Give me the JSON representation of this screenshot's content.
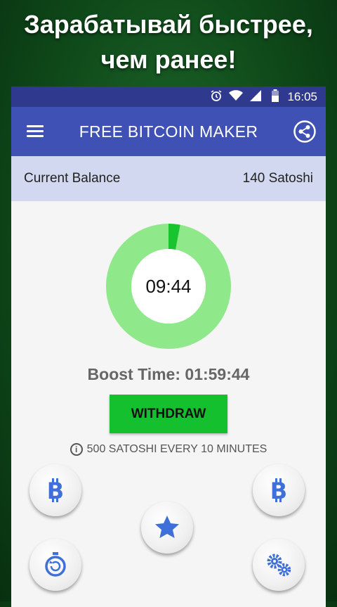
{
  "promo": {
    "line1": "Зарабатывай быстрее,",
    "line2": "чем ранее!"
  },
  "status_bar": {
    "time": "16:05",
    "icons": [
      "alarm-icon",
      "wifi-icon",
      "signal-icon",
      "battery-icon"
    ]
  },
  "app_bar": {
    "title": "FREE BITCOIN MAKER",
    "menu_icon": "hamburger-menu-icon",
    "share_icon": "share-icon"
  },
  "balance": {
    "label": "Current Balance",
    "value": "140 Satoshi"
  },
  "timer": {
    "value": "09:44",
    "progress": 0.03
  },
  "boost": {
    "text": "Boost Time: 01:59:44"
  },
  "withdraw": {
    "label": "WITHDRAW"
  },
  "info": {
    "text": "500 SATOSHI EVERY 10 MINUTES",
    "icon": "info-icon"
  },
  "action_buttons": [
    {
      "icon": "bitcoin-icon"
    },
    {
      "icon": "bitcoin-icon"
    },
    {
      "icon": "star-icon"
    },
    {
      "icon": "timer-refresh-icon"
    },
    {
      "icon": "settings-gears-icon"
    }
  ],
  "colors": {
    "app_bar": "#3f51b5",
    "status_bar": "#2f3a8f",
    "balance_bg": "#d2d8ef",
    "ring": "#8fe88a",
    "ring_progress": "#19c52e",
    "withdraw": "#15c02e",
    "icon_blue": "#3f6fd8"
  }
}
